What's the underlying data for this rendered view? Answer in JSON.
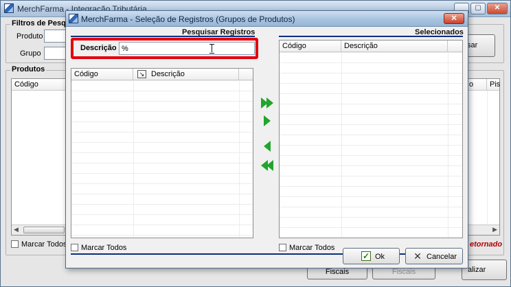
{
  "main": {
    "title": "MerchFarma - Integração Tributária",
    "filters_title": "Filtros de Pesqu",
    "produto_label": "Produto",
    "grupo_label": "Grupo",
    "search_button": "sar",
    "produtos_title": "Produtos",
    "grid_col_codigo": "Código",
    "grid_col_right1": "o",
    "grid_col_right2": "Pis",
    "marcar_todos": "Marcar Todos",
    "retornado": "etornado",
    "btn_fiscais": "Fiscais",
    "btn_fiscais_disabled": "Fiscais",
    "btn_atualizar": "alizar"
  },
  "dialog": {
    "title": "MerchFarma - Seleção de Registros (Grupos de Produtos)",
    "close_label": "✕",
    "pesquisar_title": "Pesquisar Registros",
    "selecionados_title": "Selecionados",
    "search_label": "Descrição",
    "search_value": "%",
    "left_grid": {
      "col_codigo": "Código",
      "col_descricao": "Descrição"
    },
    "right_grid": {
      "col_codigo": "Código",
      "col_descricao": "Descrição"
    },
    "marcar_todos_left": "Marcar Todos",
    "marcar_todos_right": "Marcar Todos",
    "ok_label": "Ok",
    "cancel_label": "Cancelar"
  },
  "colors": {
    "accent": "#0d2c7c",
    "highlight": "#e3000b",
    "arrow": "#22a52c",
    "retornado": "#b00000"
  }
}
